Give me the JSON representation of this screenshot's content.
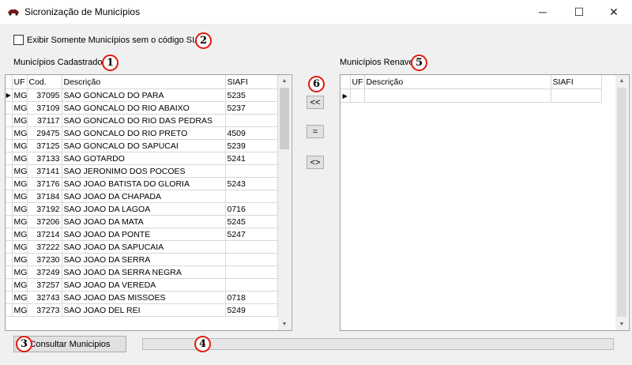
{
  "window": {
    "title": "Sicronização de Municípios",
    "minimize_glyph": "─",
    "maximize_glyph": "☐",
    "close_glyph": "✕",
    "icon": "car-icon"
  },
  "filter": {
    "label": "Exibir Somente Municípios sem o código SIAFI",
    "checked": false
  },
  "left_panel": {
    "label": "Municípios Cadastrados",
    "columns": [
      "UF",
      "Cod.",
      "Descrição",
      "SIAFI"
    ],
    "rows": [
      [
        "MG",
        "37095",
        "SAO GONCALO DO PARA",
        "5235"
      ],
      [
        "MG",
        "37109",
        "SAO GONCALO DO RIO ABAIXO",
        "5237"
      ],
      [
        "MG",
        "37117",
        "SAO GONCALO DO RIO DAS PEDRAS",
        ""
      ],
      [
        "MG",
        "29475",
        "SAO GONCALO DO RIO PRETO",
        "4509"
      ],
      [
        "MG",
        "37125",
        "SAO GONCALO DO SAPUCAI",
        "5239"
      ],
      [
        "MG",
        "37133",
        "SAO GOTARDO",
        "5241"
      ],
      [
        "MG",
        "37141",
        "SAO JERONIMO DOS POCOES",
        ""
      ],
      [
        "MG",
        "37176",
        "SAO JOAO BATISTA DO GLORIA",
        "5243"
      ],
      [
        "MG",
        "37184",
        "SAO JOAO DA CHAPADA",
        ""
      ],
      [
        "MG",
        "37192",
        "SAO JOAO DA LAGOA",
        "0716"
      ],
      [
        "MG",
        "37206",
        "SAO JOAO DA MATA",
        "5245"
      ],
      [
        "MG",
        "37214",
        "SAO JOAO DA PONTE",
        "5247"
      ],
      [
        "MG",
        "37222",
        "SAO JOAO DA SAPUCAIA",
        ""
      ],
      [
        "MG",
        "37230",
        "SAO JOAO DA SERRA",
        ""
      ],
      [
        "MG",
        "37249",
        "SAO JOAO DA SERRA NEGRA",
        ""
      ],
      [
        "MG",
        "37257",
        "SAO JOAO DA VEREDA",
        ""
      ],
      [
        "MG",
        "32743",
        "SAO JOAO DAS MISSOES",
        "0718"
      ],
      [
        "MG",
        "37273",
        "SAO JOAO DEL REI",
        "5249"
      ]
    ],
    "row_indicator": "▶"
  },
  "middle_buttons": {
    "left": "<<",
    "equal": "=",
    "swap": "<>"
  },
  "right_panel": {
    "label": "Municípios Renave",
    "columns": [
      "UF",
      "Descrição",
      "SIAFI"
    ],
    "row_indicator": "▶"
  },
  "footer": {
    "consult_button": "Consultar Municipios",
    "progress": 0
  },
  "scroll": {
    "up": "▲",
    "down": "▼"
  },
  "annotations": [
    "1",
    "2",
    "3",
    "4",
    "5",
    "6"
  ],
  "colors": {
    "annotation": "#e0190f",
    "window_bg": "#f0f0f0"
  }
}
